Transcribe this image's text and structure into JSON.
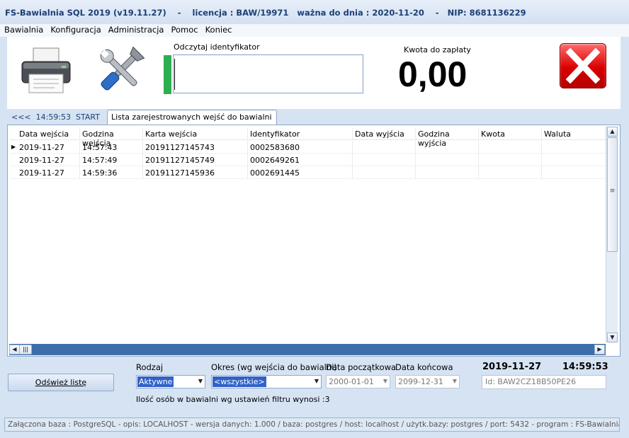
{
  "window": {
    "title": "FS-Bawialnia SQL 2019 (v19.11.27)    -    licencja : BAW/19971   ważna do dnia : 2020-11-20    -   NIP: 8681136229"
  },
  "menu": [
    "Bawialnia",
    "Konfiguracja",
    "Administracja",
    "Pomoc",
    "Koniec"
  ],
  "top": {
    "printer_icon": "printer-icon",
    "tools_icon": "tools-icon",
    "read_label": "Odczytaj identyfikator",
    "read_value": "",
    "amount_label": "Kwota do zapłaty",
    "amount": "0,00",
    "close_icon": "close-icon",
    "accent": "#2eae4f"
  },
  "tabs": {
    "back": "<<<  14:59:53  START",
    "active": "Lista zarejestrowanych wejść do bawialni"
  },
  "table": {
    "columns": [
      "Data wejścia",
      "Godzina wejścia",
      "Karta wejścia",
      "Identyfikator",
      "Data wyjścia",
      "Godzina wyjścia",
      "Kwota",
      "Waluta"
    ],
    "rows": [
      [
        "2019-11-27",
        "14:57:43",
        "20191127145743",
        "0002583680",
        "",
        "",
        "",
        ""
      ],
      [
        "2019-11-27",
        "14:57:49",
        "20191127145749",
        "0002649261",
        "",
        "",
        "",
        ""
      ],
      [
        "2019-11-27",
        "14:59:36",
        "20191127145936",
        "0002691445",
        "",
        "",
        "",
        ""
      ]
    ]
  },
  "filters": {
    "refresh": "Odśwież listę",
    "rodzaj_label": "Rodzaj",
    "rodzaj_value": "Aktywne",
    "okres_label": "Okres (wg wejścia do bawialni)",
    "okres_value": "<wszystkie>",
    "start_label": "Data początkowa",
    "start_value": "2000-01-01",
    "end_label": "Data końcowa",
    "end_value": "2099-12-31",
    "date": "2019-11-27",
    "time": "14:59:53",
    "id_value": "Id: BAW2CZ18B50PE26",
    "info": "Ilość osób w bawialni wg ustawień filtru wynosi :3"
  },
  "status": "Załączona baza : PostgreSQL - opis: LOCALHOST - wersja danych: 1.000  / baza: postgres / host: localhost / użytk.bazy: postgres /  port: 5432  - program :  FS-Bawialnia SQL edycja"
}
